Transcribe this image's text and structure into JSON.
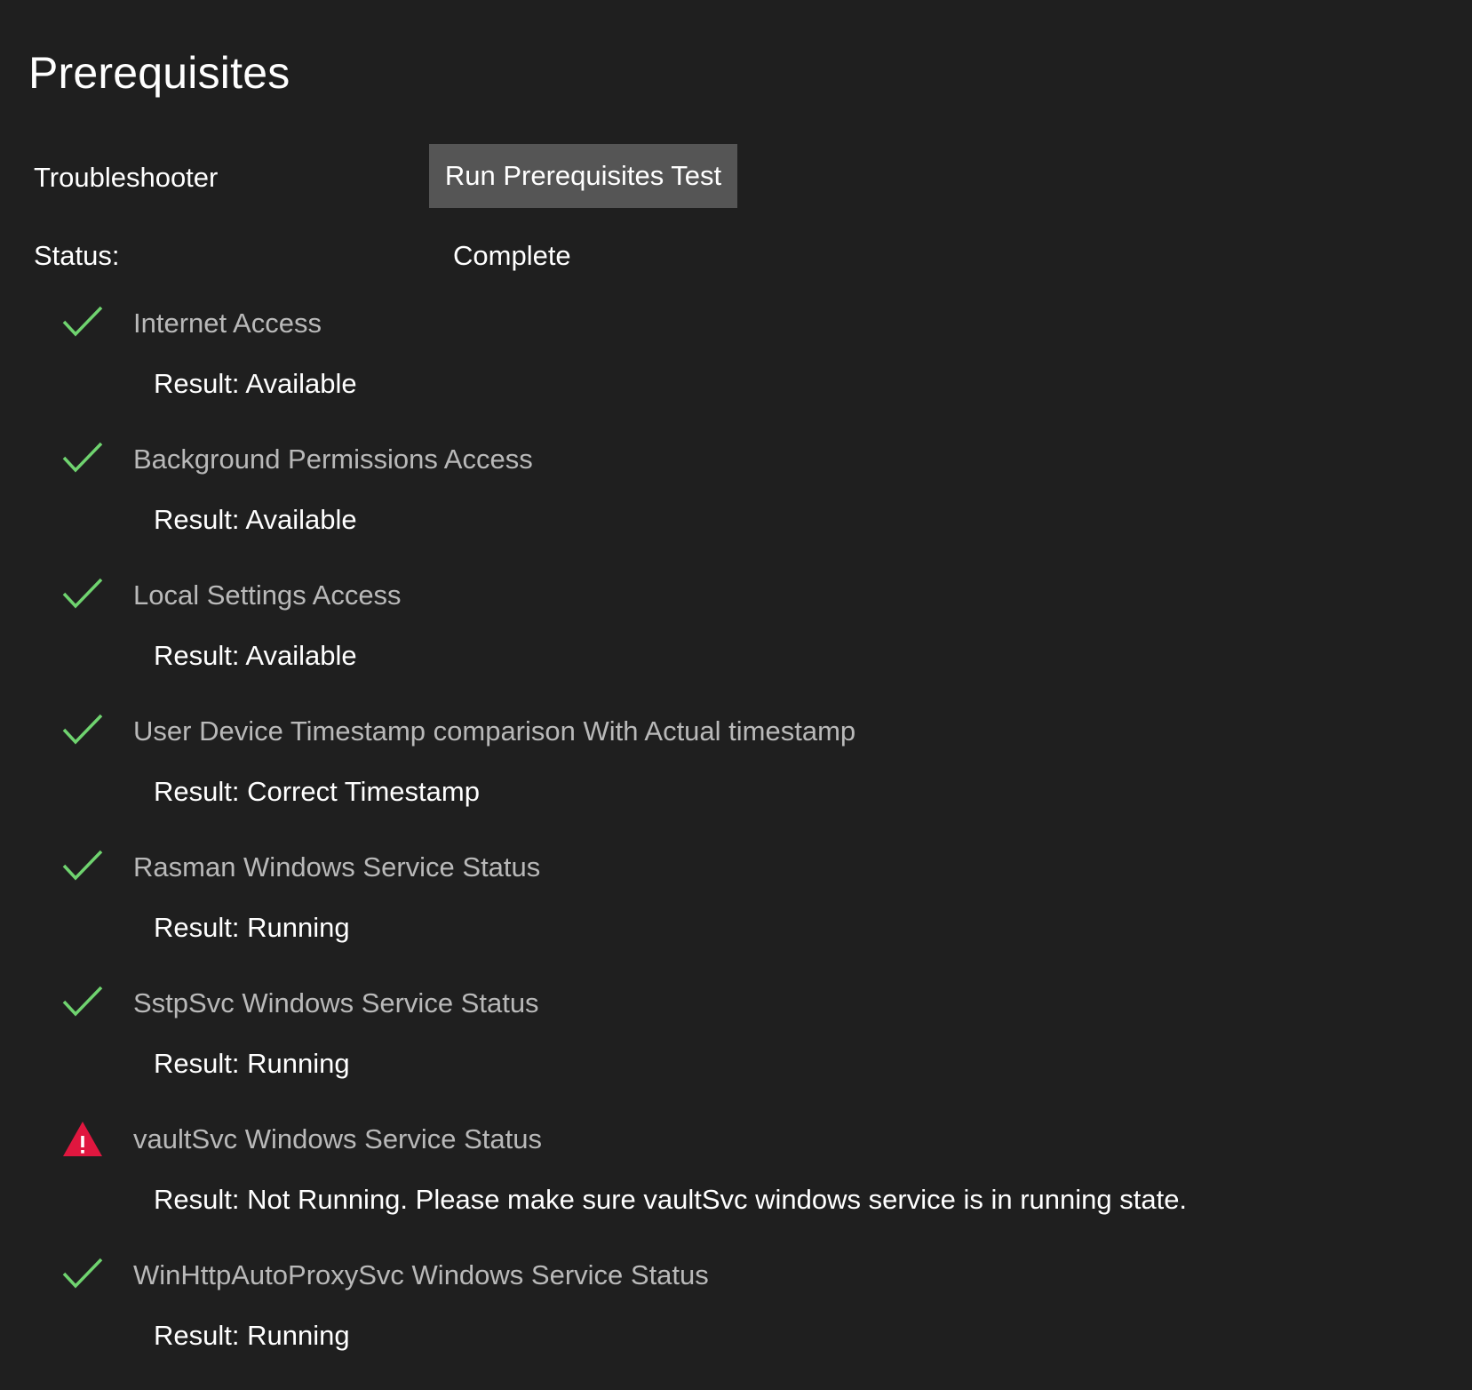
{
  "page": {
    "title": "Prerequisites"
  },
  "troubleshooter": {
    "label": "Troubleshooter",
    "button_label": "Run Prerequisites Test"
  },
  "status": {
    "label": "Status:",
    "value": "Complete"
  },
  "colors": {
    "background": "#1f1f1f",
    "button": "#555555",
    "success": "#6fd36f",
    "warning": "#e0173f"
  },
  "checks": [
    {
      "icon": "checkmark-icon",
      "state": "success",
      "title": "Internet Access",
      "result": "Result: Available"
    },
    {
      "icon": "checkmark-icon",
      "state": "success",
      "title": "Background Permissions Access",
      "result": "Result: Available"
    },
    {
      "icon": "checkmark-icon",
      "state": "success",
      "title": "Local Settings Access",
      "result": "Result: Available"
    },
    {
      "icon": "checkmark-icon",
      "state": "success",
      "title": "User Device Timestamp comparison With Actual timestamp",
      "result": "Result: Correct Timestamp"
    },
    {
      "icon": "checkmark-icon",
      "state": "success",
      "title": "Rasman Windows Service Status",
      "result": "Result: Running"
    },
    {
      "icon": "checkmark-icon",
      "state": "success",
      "title": "SstpSvc Windows Service Status",
      "result": "Result: Running"
    },
    {
      "icon": "warning-icon",
      "state": "warning",
      "title": "vaultSvc Windows Service Status",
      "result": "Result: Not Running. Please make sure vaultSvc windows service is in running state."
    },
    {
      "icon": "checkmark-icon",
      "state": "success",
      "title": "WinHttpAutoProxySvc Windows Service Status",
      "result": "Result: Running"
    }
  ]
}
